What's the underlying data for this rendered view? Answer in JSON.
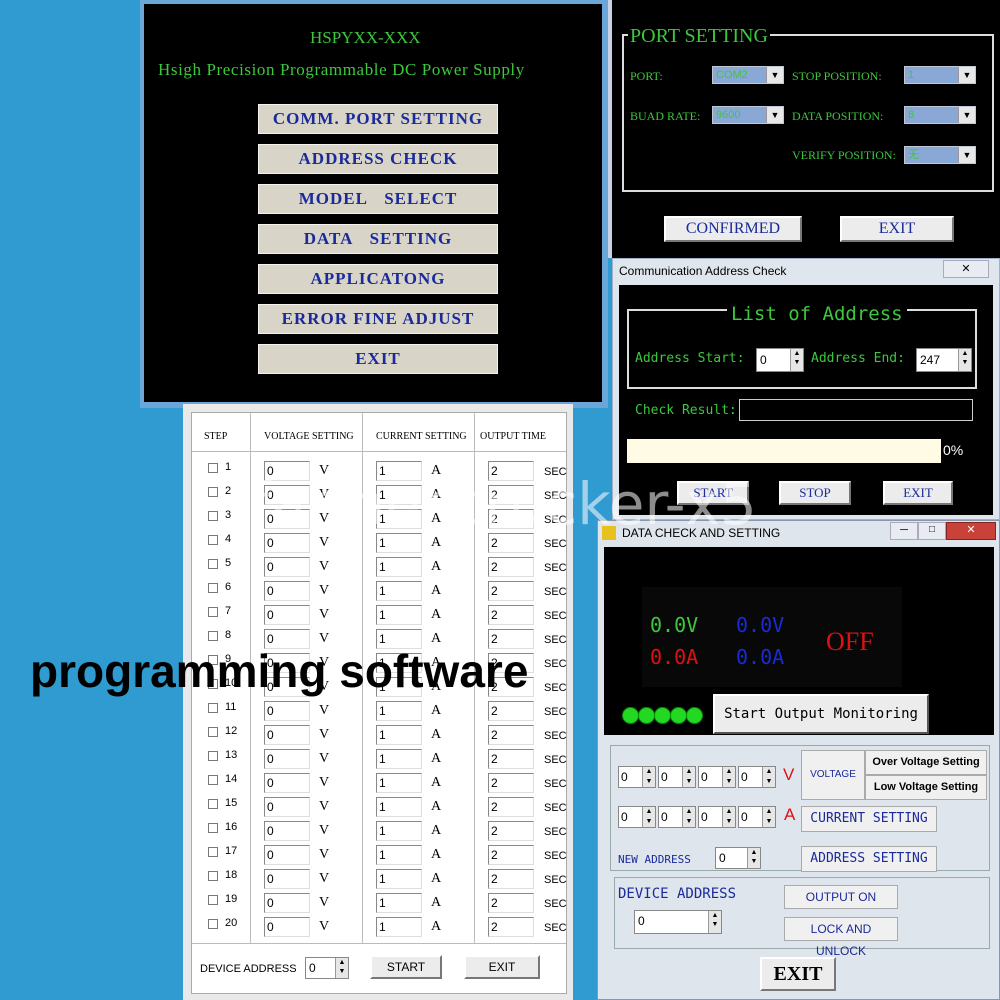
{
  "main_menu": {
    "model": "HSPYXX-XXX",
    "subtitle": "Hsigh Precision Programmable DC Power Supply",
    "buttons": [
      "COMM. PORT SETTING",
      "ADDRESS CHECK",
      "MODEL SELECT",
      "DATA SETTING",
      "APPLICATONG",
      "ERROR FINE ADJUST",
      "EXIT"
    ]
  },
  "port_setting": {
    "title": "PORT SETTING",
    "port_label": "PORT:",
    "port_value": "COM2",
    "baud_label": "BUAD RATE:",
    "baud_value": "9600",
    "stop_label": "STOP POSITION:",
    "stop_value": "1",
    "data_label": "DATA POSITION:",
    "data_value": "8",
    "verify_label": "VERIFY POSITION:",
    "verify_value": "无",
    "confirm_label": "CONFIRMED",
    "exit_label": "EXIT"
  },
  "comm_check": {
    "window_title": "Communication Address Check",
    "close_glyph": "✕",
    "list_title": "List of Address",
    "start_label": "Address Start:",
    "start_value": "0",
    "end_label": "Address End:",
    "end_value": "247",
    "result_label": "Check Result:",
    "progress_pct": "0%",
    "progress_value": 0,
    "start_btn": "START",
    "stop_btn": "STOP",
    "exit_btn": "EXIT"
  },
  "step_table": {
    "headers": [
      "STEP",
      "VOLTAGE SETTING",
      "CURRENT SETTING",
      "OUTPUT TIME"
    ],
    "rows": [
      {
        "step": "1",
        "v": "0",
        "c": "1",
        "t": "2"
      },
      {
        "step": "2",
        "v": "0",
        "c": "1",
        "t": "2"
      },
      {
        "step": "3",
        "v": "0",
        "c": "1",
        "t": "2"
      },
      {
        "step": "4",
        "v": "0",
        "c": "1",
        "t": "2"
      },
      {
        "step": "5",
        "v": "0",
        "c": "1",
        "t": "2"
      },
      {
        "step": "6",
        "v": "0",
        "c": "1",
        "t": "2"
      },
      {
        "step": "7",
        "v": "0",
        "c": "1",
        "t": "2"
      },
      {
        "step": "8",
        "v": "0",
        "c": "1",
        "t": "2"
      },
      {
        "step": "9",
        "v": "0",
        "c": "1",
        "t": "2"
      },
      {
        "step": "10",
        "v": "0",
        "c": "1",
        "t": "2"
      },
      {
        "step": "11",
        "v": "0",
        "c": "1",
        "t": "2"
      },
      {
        "step": "12",
        "v": "0",
        "c": "1",
        "t": "2"
      },
      {
        "step": "13",
        "v": "0",
        "c": "1",
        "t": "2"
      },
      {
        "step": "14",
        "v": "0",
        "c": "1",
        "t": "2"
      },
      {
        "step": "15",
        "v": "0",
        "c": "1",
        "t": "2"
      },
      {
        "step": "16",
        "v": "0",
        "c": "1",
        "t": "2"
      },
      {
        "step": "17",
        "v": "0",
        "c": "1",
        "t": "2"
      },
      {
        "step": "18",
        "v": "0",
        "c": "1",
        "t": "2"
      },
      {
        "step": "19",
        "v": "0",
        "c": "1",
        "t": "2"
      },
      {
        "step": "20",
        "v": "0",
        "c": "1",
        "t": "2"
      }
    ],
    "unit_v": "V",
    "unit_a": "A",
    "unit_sec": "SEC",
    "device_label": "DEVICE ADDRESS",
    "device_value": "0",
    "start_btn": "START",
    "exit_btn": "EXIT"
  },
  "data_check": {
    "window_title": "DATA CHECK AND SETTING",
    "set_voltage": "0.0V",
    "set_current": "0.0A",
    "out_voltage": "0.0V",
    "out_current": "0.0A",
    "status": "OFF",
    "monitor_btn": "Start Output Monitoring",
    "voltage_digits": [
      "0",
      "0",
      "0",
      "0"
    ],
    "current_digits": [
      "0",
      "0",
      "0",
      "0"
    ],
    "unit_v": "V",
    "unit_a": "A",
    "voltage_label": "VOLTAGE",
    "over_voltage": "Over Voltage Setting",
    "low_voltage": "Low Voltage Setting",
    "current_setting": "CURRENT SETTING",
    "new_address_label": "NEW ADDRESS",
    "new_address_value": "0",
    "address_setting": "ADDRESS SETTING",
    "device_address_label": "DEVICE ADDRESS",
    "device_address_value": "0",
    "output_on": "OUTPUT ON",
    "lock_unlock": "LOCK AND UNLOCK",
    "exit_btn": "EXIT"
  },
  "watermark": "farmer-trucker-x5",
  "caption": "programming software",
  "colors": {
    "green": "#3cc83c",
    "navy": "#1a2a9a",
    "red": "#e01010",
    "blue": "#1a2ad8"
  }
}
